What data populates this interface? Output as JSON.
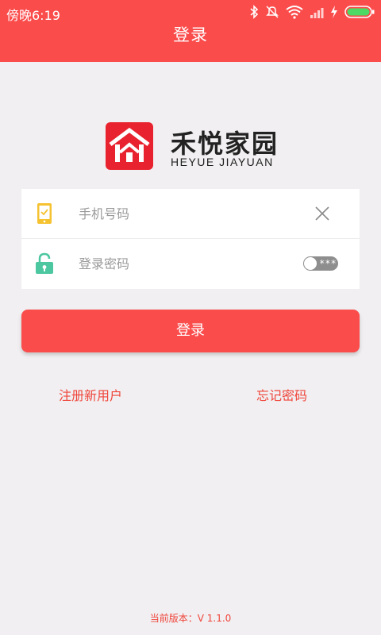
{
  "status": {
    "time": "傍晚6:19"
  },
  "header": {
    "title": "登录"
  },
  "brand": {
    "name_cn": "禾悦家园",
    "name_en": "HEYUE JIAYUAN"
  },
  "form": {
    "phone_placeholder": "手机号码",
    "password_placeholder": "登录密码",
    "password_mask": "***"
  },
  "buttons": {
    "login": "登录"
  },
  "links": {
    "register": "注册新用户",
    "forgot": "忘记密码"
  },
  "footer": {
    "version": "当前版本：V 1.1.0"
  },
  "colors": {
    "accent": "#fb4c4c",
    "link": "#f0463c",
    "background": "#f1eff1",
    "phone_icon": "#f5c231",
    "lock_icon": "#4cc7a0"
  },
  "icons": [
    "bluetooth-icon",
    "mute-icon",
    "wifi-icon",
    "signal-icon",
    "charging-icon",
    "battery-icon",
    "phone-icon",
    "lock-icon",
    "clear-icon"
  ]
}
